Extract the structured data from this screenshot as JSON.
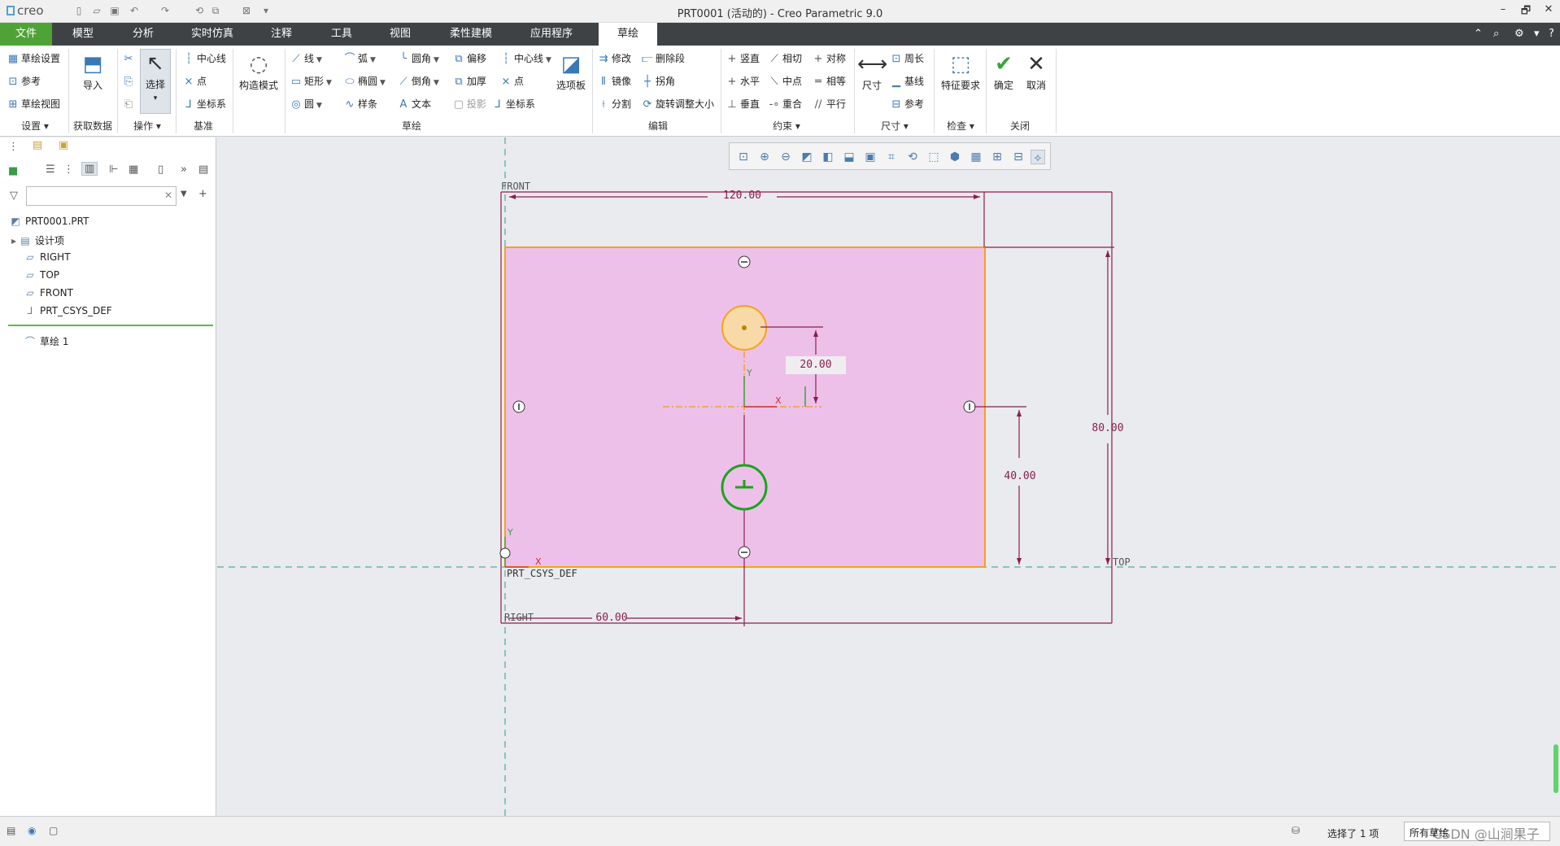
{
  "app": {
    "logo": "creo",
    "window_title": "PRT0001 (活动的) - Creo Parametric 9.0",
    "window_controls": [
      "–",
      "🗗",
      "✕"
    ]
  },
  "menu": {
    "tabs": [
      "文件",
      "模型",
      "分析",
      "实时仿真",
      "注释",
      "工具",
      "视图",
      "柔性建模",
      "应用程序",
      "草绘"
    ],
    "active": "草绘"
  },
  "ribbon": {
    "setup": {
      "sketch_setup": "草绘设置",
      "reference": "参考",
      "sketch_view": "草绘视图",
      "group": "设置"
    },
    "get_data": {
      "import": "导入",
      "group": "获取数据"
    },
    "operations": {
      "select": "选择",
      "group": "操作"
    },
    "datum": {
      "centerline": "中心线",
      "point": "点",
      "csys": "坐标系",
      "group": "基准"
    },
    "construction": {
      "label": "构造模式"
    },
    "sketching": {
      "line": "线",
      "arc": "弧",
      "fillet": "圆角",
      "offset": "偏移",
      "centerline": "中心线",
      "rectangle": "矩形",
      "ellipse": "椭圆",
      "chamfer": "倒角",
      "thicken": "加厚",
      "point": "点",
      "circle": "圆",
      "spline": "样条",
      "text": "文本",
      "project": "投影",
      "csys": "坐标系",
      "palette": "选项板",
      "group": "草绘"
    },
    "editing": {
      "modify": "修改",
      "delete_segment": "删除段",
      "mirror": "镜像",
      "corner": "拐角",
      "divide": "分割",
      "rotate_resize": "旋转调整大小",
      "group": "编辑"
    },
    "constrain": {
      "vertical": "竖直",
      "tangent": "相切",
      "symmetric": "对称",
      "horizontal": "水平",
      "midpoint": "中点",
      "equal": "相等",
      "perpendicular": "垂直",
      "coincident": "重合",
      "parallel": "平行",
      "group": "约束"
    },
    "dimension": {
      "dimension": "尺寸",
      "perimeter": "周长",
      "baseline": "基线",
      "reference": "参考",
      "group": "尺寸"
    },
    "inspect": {
      "feature_requirements": "特征要求",
      "group": "检查"
    },
    "close": {
      "ok": "确定",
      "cancel": "取消",
      "group": "关闭"
    }
  },
  "model_tree": {
    "filter_placeholder": "",
    "items": [
      "PRT0001.PRT",
      "设计项",
      "RIGHT",
      "TOP",
      "FRONT",
      "PRT_CSYS_DEF",
      "草绘 1"
    ]
  },
  "sketch": {
    "dims": {
      "width": "120.00",
      "height": "80.00",
      "hole_offset": "20.00",
      "hole_height": "40.00",
      "hole_x": "60.00"
    },
    "labels": {
      "front": "FRONT",
      "top": "TOP",
      "right": "RIGHT",
      "csys": "PRT_CSYS_DEF",
      "x_axis": "X",
      "y_axis": "Y"
    },
    "colors": {
      "fill": "#edc0ea",
      "edge": "#f7a21a",
      "dim": "#8c1d4e",
      "hole": "#1aa51a",
      "datum": "#2c9e8e"
    }
  },
  "status": {
    "selection": "选择了 1 项",
    "filter": "所有草绘",
    "watermark": "CSDN @山涧果子"
  }
}
